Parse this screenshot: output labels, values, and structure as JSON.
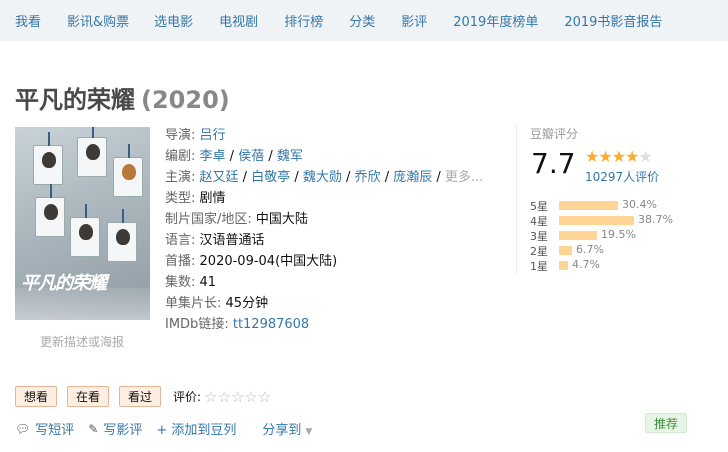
{
  "nav": [
    "我看",
    "影讯&购票",
    "选电影",
    "电视剧",
    "排行榜",
    "分类",
    "影评",
    "2019年度榜单",
    "2019书影音报告"
  ],
  "title": {
    "name": "平凡的荣耀",
    "year": "(2020)"
  },
  "poster": {
    "title": "平凡的荣耀",
    "update_link": "更新描述或海报"
  },
  "info": {
    "director_label": "导演:",
    "director": "吕行",
    "writer_label": "编剧:",
    "writers": [
      "李卓",
      "侯蓓",
      "魏军"
    ],
    "cast_label": "主演:",
    "cast": [
      "赵又廷",
      "白敬亭",
      "魏大勋",
      "乔欣",
      "庞瀚辰"
    ],
    "cast_more": "更多...",
    "genre_label": "类型:",
    "genre": "剧情",
    "country_label": "制片国家/地区:",
    "country": "中国大陆",
    "language_label": "语言:",
    "language": "汉语普通话",
    "premiere_label": "首播:",
    "premiere": "2020-09-04(中国大陆)",
    "episodes_label": "集数:",
    "episodes": "41",
    "runtime_label": "单集片长:",
    "runtime": "45分钟",
    "imdb_label": "IMDb链接:",
    "imdb": "tt12987608"
  },
  "rating": {
    "label": "豆瓣评分",
    "score": "7.7",
    "stars_filled": 4,
    "votes": "10297人评价",
    "distribution": [
      {
        "label": "5星",
        "pct": "30.4%",
        "value": 30.4
      },
      {
        "label": "4星",
        "pct": "38.7%",
        "value": 38.7
      },
      {
        "label": "3星",
        "pct": "19.5%",
        "value": 19.5
      },
      {
        "label": "2星",
        "pct": "6.7%",
        "value": 6.7
      },
      {
        "label": "1星",
        "pct": "4.7%",
        "value": 4.7
      }
    ],
    "accent_color": "#ffac2d",
    "bar_color": "#ffd596"
  },
  "actions": {
    "want": "想看",
    "watching": "在看",
    "watched": "看过",
    "rate_label": "评价:"
  },
  "bottom": {
    "short_review": "写短评",
    "review": "写影评",
    "add_doulist": "+ 添加到豆列",
    "share": "分享到",
    "recommend": "推荐"
  }
}
